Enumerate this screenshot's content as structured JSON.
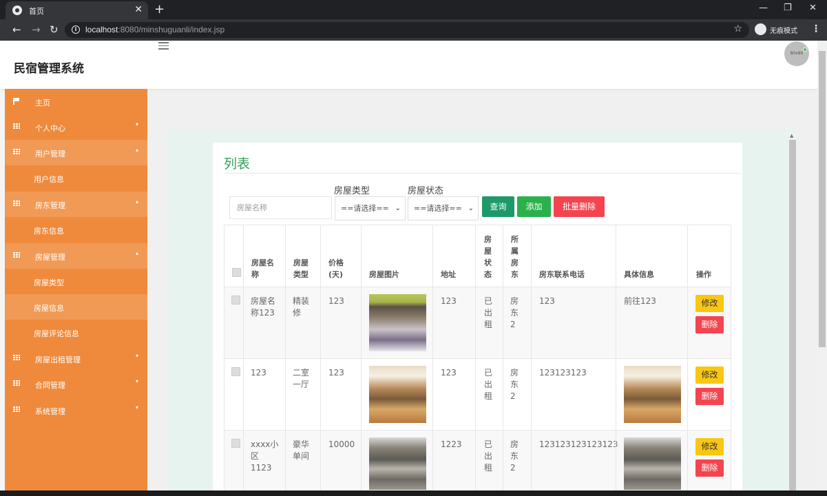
{
  "browser": {
    "tab_title": "首页",
    "tab_close": "✕",
    "new_tab": "+",
    "url_host": "localhost",
    "url_rest": ":8080/minshuguanli/index.jsp",
    "incognito_label": "无痕模式",
    "window_controls": [
      "—",
      "❐",
      "✕"
    ]
  },
  "header": {
    "brand": "民宿管理系统",
    "avatar_text": "80x80"
  },
  "sidebar": {
    "items": [
      {
        "label": "主页",
        "icon": "flag-icon"
      },
      {
        "label": "个人中心",
        "icon": "grid-icon",
        "arrow": "▾"
      },
      {
        "label": "用户管理",
        "icon": "grid-icon",
        "arrow": "▴"
      },
      {
        "label": "用户信息",
        "sub": true
      },
      {
        "label": "房东管理",
        "icon": "grid-icon",
        "arrow": "▴"
      },
      {
        "label": "房东信息",
        "sub": true
      },
      {
        "label": "房屋管理",
        "icon": "grid-icon",
        "arrow": "▴"
      },
      {
        "label": "房屋类型",
        "sub": true
      },
      {
        "label": "房屋信息",
        "sub": true,
        "active": true
      },
      {
        "label": "房屋评论信息",
        "sub": true
      },
      {
        "label": "房屋出租管理",
        "icon": "grid-icon",
        "arrow": "▾"
      },
      {
        "label": "合同管理",
        "icon": "grid-icon",
        "arrow": "▾"
      },
      {
        "label": "系统管理",
        "icon": "grid-icon",
        "arrow": "▾"
      }
    ]
  },
  "panel": {
    "title": "列表",
    "filters": {
      "name_placeholder": "房屋名称",
      "type_label": "房屋类型",
      "type_value": "==请选择==",
      "status_label": "房屋状态",
      "status_value": "==请选择=="
    },
    "buttons": {
      "query": "查询",
      "add": "添加",
      "batch_delete": "批量删除"
    },
    "table": {
      "headers": [
        "房屋名称",
        "房屋类型",
        "价格(天)",
        "房屋图片",
        "地址",
        "房屋状态",
        "所属房东",
        "房东联系电话",
        "具体信息",
        "操作"
      ],
      "rows": [
        {
          "name": "房屋名称123",
          "type": "精装修",
          "price": "123",
          "image": "bedroom-photo",
          "address": "123",
          "status": "已出租",
          "landlord": "房东2",
          "phone": "123",
          "detail": "前往123",
          "edit": "修改",
          "delete": "删除"
        },
        {
          "name": "123",
          "type": "二室一厅",
          "price": "123",
          "image": "living-room-photo",
          "address": "123",
          "status": "已出租",
          "landlord": "房东2",
          "phone": "123123123",
          "detail": "living-room-photo",
          "edit": "修改",
          "delete": "删除"
        },
        {
          "name": "xxxx小区1123",
          "type": "豪华单间",
          "price": "10000",
          "image": "kitchen-photo",
          "address": "1223",
          "status": "已出租",
          "landlord": "房东2",
          "phone": "123123123123123",
          "detail": "kitchen-photo",
          "edit": "修改",
          "delete": "删除"
        }
      ]
    }
  },
  "colors": {
    "sidebar_bg": "#ef8a3c",
    "sidebar_open_bg": "#f19a55",
    "title_green": "#31a05c",
    "query_btn": "#1c9a6a",
    "add_btn": "#2ab14c",
    "delete_btn": "#f4444f",
    "edit_btn": "#f9c712"
  }
}
